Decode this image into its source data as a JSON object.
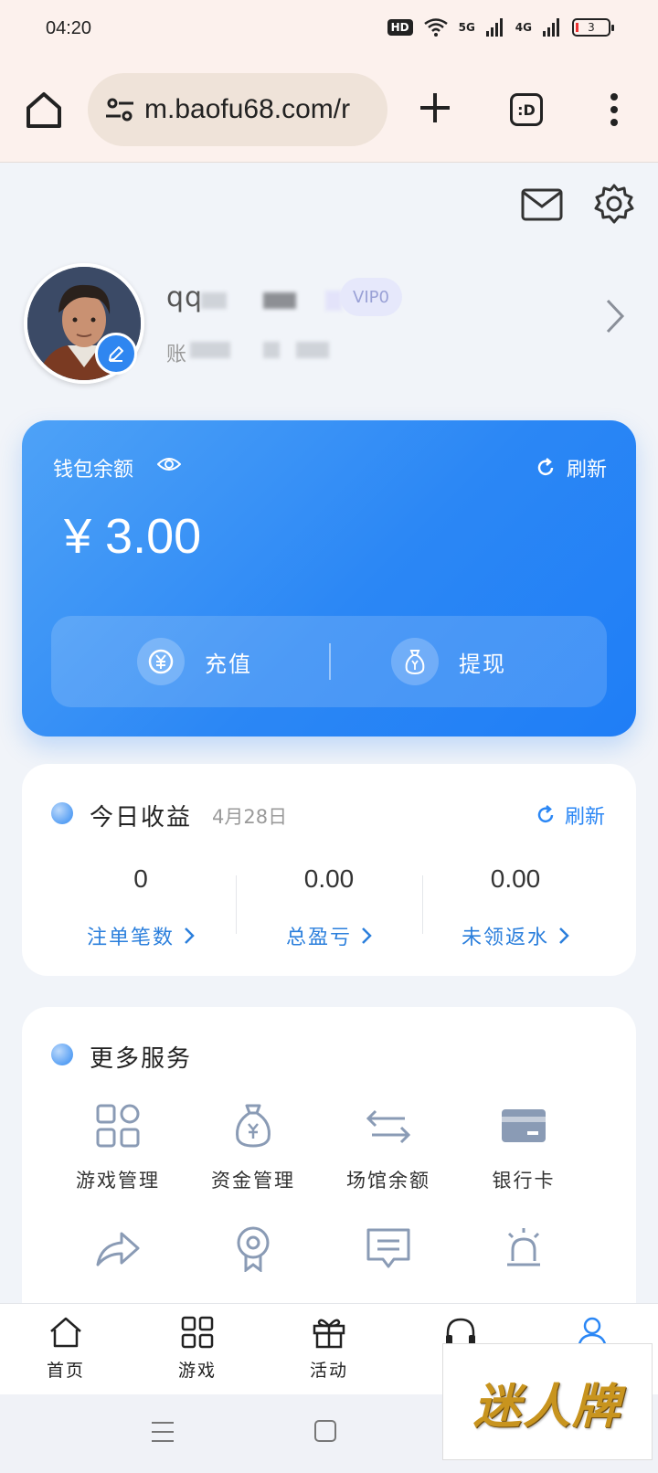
{
  "status_bar": {
    "time": "04:20",
    "hd_label": "HD",
    "net1": "5G",
    "net2": "4G",
    "battery": "3"
  },
  "browser": {
    "url": "m.baofu68.com/r",
    "tab_label": ":D"
  },
  "profile": {
    "username": "qq",
    "vip": "VIP0",
    "account_prefix": "账"
  },
  "wallet": {
    "label": "钱包余额",
    "refresh": "刷新",
    "amount": "¥ 3.00",
    "recharge": "充值",
    "withdraw": "提现",
    "accent": "#2b87f5"
  },
  "today": {
    "title": "今日收益",
    "date": "4月28日",
    "refresh": "刷新",
    "stats": [
      {
        "value": "0",
        "label": "注单笔数"
      },
      {
        "value": "0.00",
        "label": "总盈亏"
      },
      {
        "value": "0.00",
        "label": "未领返水"
      }
    ]
  },
  "services": {
    "title": "更多服务",
    "items": [
      {
        "label": "游戏管理",
        "icon": "grid-icon"
      },
      {
        "label": "资金管理",
        "icon": "money-bag-icon"
      },
      {
        "label": "场馆余额",
        "icon": "transfer-icon"
      },
      {
        "label": "银行卡",
        "icon": "bank-card-icon"
      },
      {
        "label": "",
        "icon": "share-icon"
      },
      {
        "label": "",
        "icon": "medal-icon"
      },
      {
        "label": "",
        "icon": "message-icon"
      },
      {
        "label": "",
        "icon": "alarm-icon"
      }
    ]
  },
  "bottom_nav": {
    "items": [
      {
        "label": "首页",
        "icon": "home-icon"
      },
      {
        "label": "游戏",
        "icon": "grid-icon"
      },
      {
        "label": "活动",
        "icon": "gift-icon"
      },
      {
        "label": "",
        "icon": "headset-icon"
      },
      {
        "label": "",
        "icon": "user-icon"
      }
    ]
  },
  "watermark": "迷人牌"
}
